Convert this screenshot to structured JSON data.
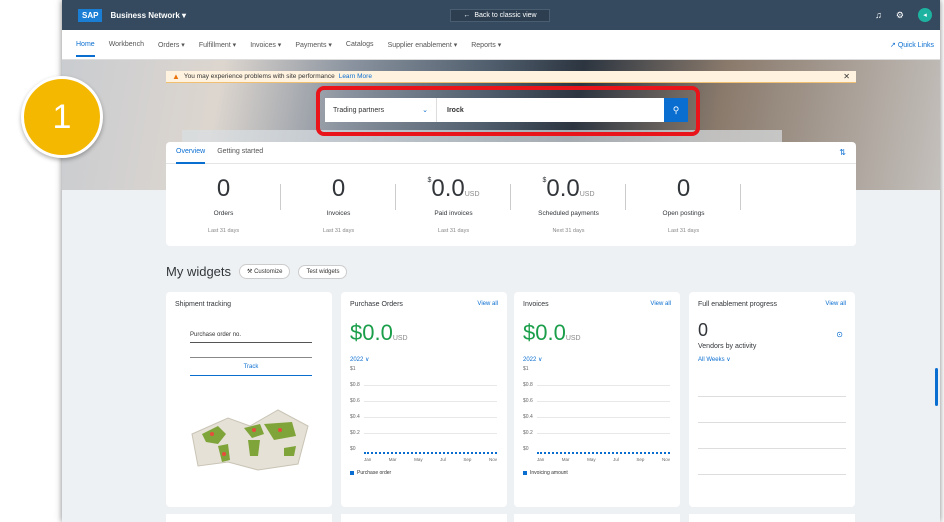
{
  "step_badge": "1",
  "shell": {
    "logo": "SAP",
    "product": "Business Network ▾",
    "back_button": "Back to classic view",
    "avatar": "◂"
  },
  "nav": {
    "items": [
      "Home",
      "Workbench",
      "Orders ▾",
      "Fulfillment ▾",
      "Invoices ▾",
      "Payments ▾",
      "Catalogs",
      "Supplier enablement ▾",
      "Reports ▾"
    ],
    "quick_links": "Quick Links"
  },
  "warning": {
    "text": "You may experience problems with site performance",
    "link": "Learn More"
  },
  "search": {
    "scope": "Trading partners",
    "query": "Irock"
  },
  "overview": {
    "tabs": [
      "Overview",
      "Getting started"
    ],
    "metrics": [
      {
        "value": "0",
        "prefix": "",
        "unit": "",
        "label": "Orders",
        "sub": "Last 31 days"
      },
      {
        "value": "0",
        "prefix": "",
        "unit": "",
        "label": "Invoices",
        "sub": "Last 31 days"
      },
      {
        "value": "0.0",
        "prefix": "$",
        "unit": "USD",
        "label": "Paid invoices",
        "sub": "Last 31 days"
      },
      {
        "value": "0.0",
        "prefix": "$",
        "unit": "USD",
        "label": "Scheduled payments",
        "sub": "Next 31 days"
      },
      {
        "value": "0",
        "prefix": "",
        "unit": "",
        "label": "Open postings",
        "sub": "Last 31 days"
      }
    ]
  },
  "widgets": {
    "title": "My widgets",
    "customize": "Customize",
    "test": "Test widgets"
  },
  "shipment": {
    "title": "Shipment tracking",
    "field": "Purchase order no.",
    "track": "Track"
  },
  "po_card": {
    "title": "Purchase Orders",
    "view_all": "View all",
    "amount": "$0.0",
    "unit": "USD",
    "year": "2022 ∨",
    "y_labels": [
      "$1",
      "$0.8",
      "$0.6",
      "$0.4",
      "$0.2",
      "$0"
    ],
    "x_labels": [
      "Jan",
      "Mar",
      "May",
      "Jul",
      "Sep",
      "Nov"
    ],
    "legend": "Purchase order"
  },
  "inv_card": {
    "title": "Invoices",
    "view_all": "View all",
    "amount": "$0.0",
    "unit": "USD",
    "year": "2022 ∨",
    "y_labels": [
      "$1",
      "$0.8",
      "$0.6",
      "$0.4",
      "$0.2",
      "$0"
    ],
    "x_labels": [
      "Jan",
      "Mar",
      "May",
      "Jul",
      "Sep",
      "Nov"
    ],
    "legend": "Invoicing amount"
  },
  "enable_card": {
    "title": "Full enablement progress",
    "view_all": "View all",
    "value": "0",
    "label": "Vendors by activity",
    "filter": "All Weeks ∨"
  }
}
